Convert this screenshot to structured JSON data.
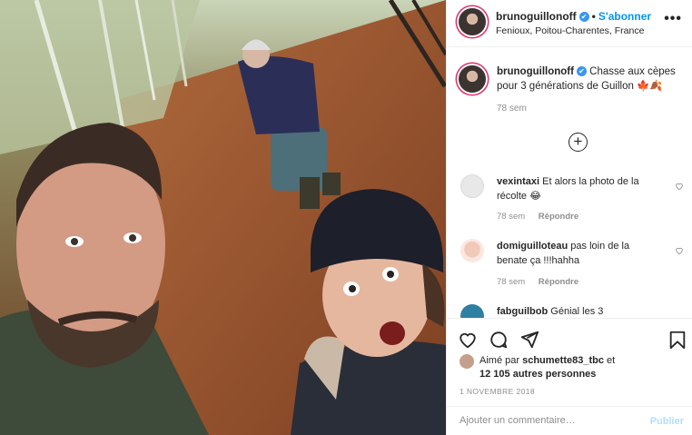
{
  "post": {
    "username": "brunoguillonoff",
    "follow_label": "S'abonner",
    "location": "Fenioux, Poitou-Charentes, France",
    "verified_icon": "verified-badge-icon",
    "more_icon": "more-options-icon",
    "more_glyph": "•••"
  },
  "caption": {
    "username": "brunoguillonoff",
    "text": "Chasse aux cèpes pour 3 générations de Guillon 🍁🍂",
    "time": "78 sem"
  },
  "load_more": {
    "icon": "plus-circle-icon",
    "glyph": "+"
  },
  "comments": [
    {
      "username": "vexintaxi",
      "text": "Et alors la photo de la récolte 😂",
      "time": "78 sem",
      "reply": "Répondre"
    },
    {
      "username": "domiguilloteau",
      "text": "pas loin de la benate ça !!!hahha",
      "time": "78 sem",
      "reply": "Répondre"
    },
    {
      "username": "fabguilbob",
      "text": "Génial les 3"
    }
  ],
  "actions": {
    "icons": [
      "heart-icon",
      "comment-icon",
      "share-icon",
      "bookmark-icon"
    ],
    "liked_by_prefix": "Aimé par",
    "liked_by_user": "schumette83_tbc",
    "liked_by_and": "et",
    "others": "12 105 autres personnes",
    "date": "1 NOVEMBRE 2018"
  },
  "add_comment": {
    "placeholder": "Ajouter un commentaire…",
    "publish": "Publier"
  },
  "colors": {
    "accent": "#0095f6",
    "verified": "#3897f0",
    "muted": "#8e8e8e"
  }
}
